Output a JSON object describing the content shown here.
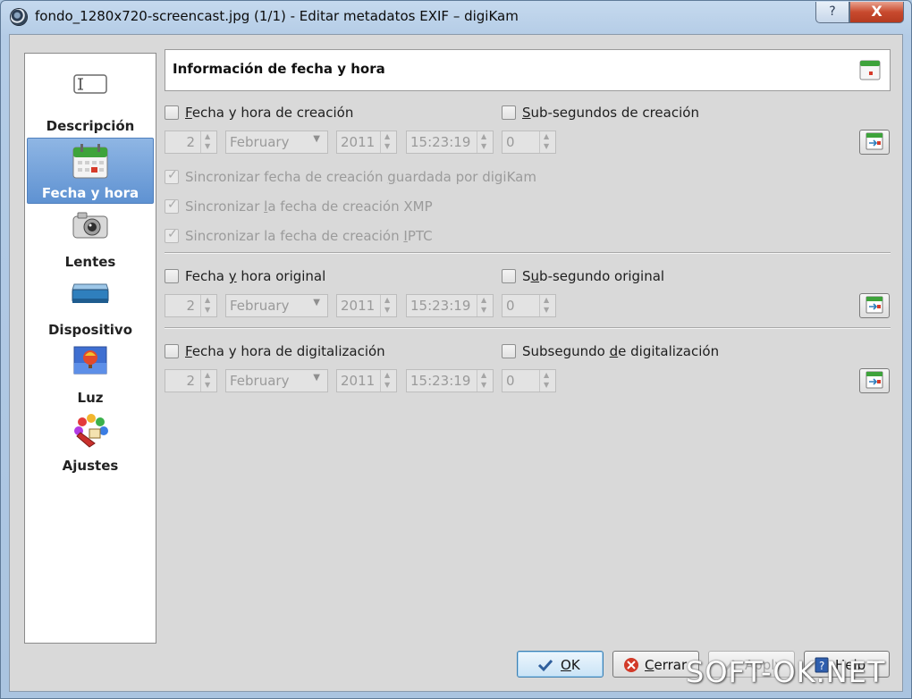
{
  "window": {
    "title": "fondo_1280x720-screencast.jpg (1/1) - Editar metadatos EXIF – digiKam",
    "help_label": "?",
    "close_label": "X"
  },
  "sidebar": {
    "items": [
      {
        "label": "Descripción",
        "icon": "text-field-icon"
      },
      {
        "label": "Fecha y hora",
        "icon": "calendar-icon",
        "active": true
      },
      {
        "label": "Lentes",
        "icon": "camera-icon"
      },
      {
        "label": "Dispositivo",
        "icon": "scanner-icon"
      },
      {
        "label": "Luz",
        "icon": "balloon-photo-icon"
      },
      {
        "label": "Ajustes",
        "icon": "palette-icon"
      }
    ]
  },
  "header": {
    "title": "Información de fecha y hora"
  },
  "creation": {
    "datetime_label_pre": "",
    "datetime_label_u": "F",
    "datetime_label_post": "echa y hora de creación",
    "subsec_label_pre": "",
    "subsec_label_u": "S",
    "subsec_label_post": "ub-segundos de creación",
    "day": "2",
    "month": "February",
    "year": "2011",
    "time": "15:23:19",
    "subsec": "0",
    "sync_digikam_pre": "Sincronizar fecha de creación ",
    "sync_digikam_u": "g",
    "sync_digikam_post": "uardada por digiKam",
    "sync_xmp_pre": "Sincronizar ",
    "sync_xmp_u": "l",
    "sync_xmp_post": "a fecha de creación XMP",
    "sync_iptc_pre": "Sincronizar la fecha de creación ",
    "sync_iptc_u": "I",
    "sync_iptc_post": "PTC"
  },
  "original": {
    "datetime_label_pre": "Fecha ",
    "datetime_label_u": "y",
    "datetime_label_post": " hora original",
    "subsec_label_pre": "S",
    "subsec_label_u": "u",
    "subsec_label_post": "b-segundo original",
    "day": "2",
    "month": "February",
    "year": "2011",
    "time": "15:23:19",
    "subsec": "0"
  },
  "digitization": {
    "datetime_label_pre": "",
    "datetime_label_u": "F",
    "datetime_label_post": "echa y hora de digitalización",
    "subsec_label_pre": "Subsegundo ",
    "subsec_label_u": "d",
    "subsec_label_post": "e digitalización",
    "day": "2",
    "month": "February",
    "year": "2011",
    "time": "15:23:19",
    "subsec": "0"
  },
  "buttons": {
    "ok_u": "O",
    "ok_post": "K",
    "cerrar_u": "C",
    "cerrar_post": "errar",
    "apply_label": "Apply",
    "help_label": "Help"
  },
  "watermark": "SOFT-OK.NET"
}
